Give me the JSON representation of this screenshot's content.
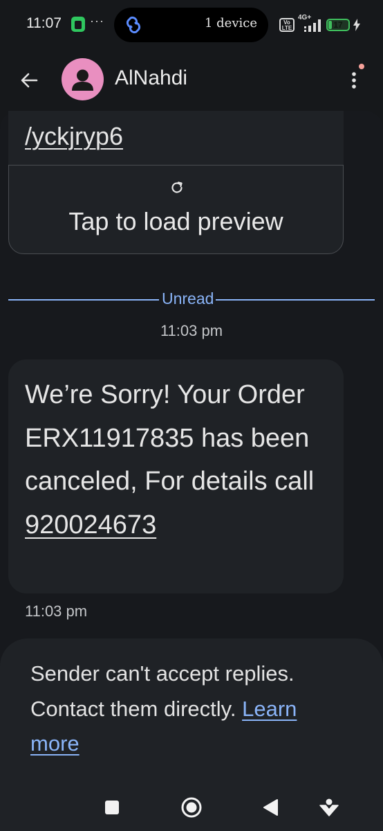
{
  "status_bar": {
    "time": "11:07",
    "dots": "···",
    "island_label": "1 device",
    "volte": "Vo LTE",
    "network": "4G+",
    "battery_level": 17
  },
  "header": {
    "contact_name": "AlNahdi"
  },
  "messages": {
    "link_tail": "/yckjryp6",
    "preview_action": "Tap to load preview",
    "unread_label": "Unread",
    "time_top": "11:03 pm",
    "main_body": "We’re Sorry! Your Order ERX11917835 has been canceled, For details call ",
    "main_phone": "920024673",
    "time_bottom": "11:03 pm"
  },
  "reply_notice": {
    "text": "Sender can't accept replies. Contact them directly. ",
    "link": "Learn more"
  },
  "colors": {
    "background": "#16181b",
    "bubble": "#1f2226",
    "accent_blue": "#8ab4f8",
    "avatar_pink": "#e98fc0",
    "battery_green": "#3fbf5d"
  },
  "icons": {
    "back": "arrow-left-icon",
    "menu": "more-vertical-icon",
    "reload": "refresh-icon",
    "nav_recents": "square-icon",
    "nav_home": "circle-icon",
    "nav_back": "triangle-back-icon",
    "nav_assist": "assistant-icon"
  }
}
